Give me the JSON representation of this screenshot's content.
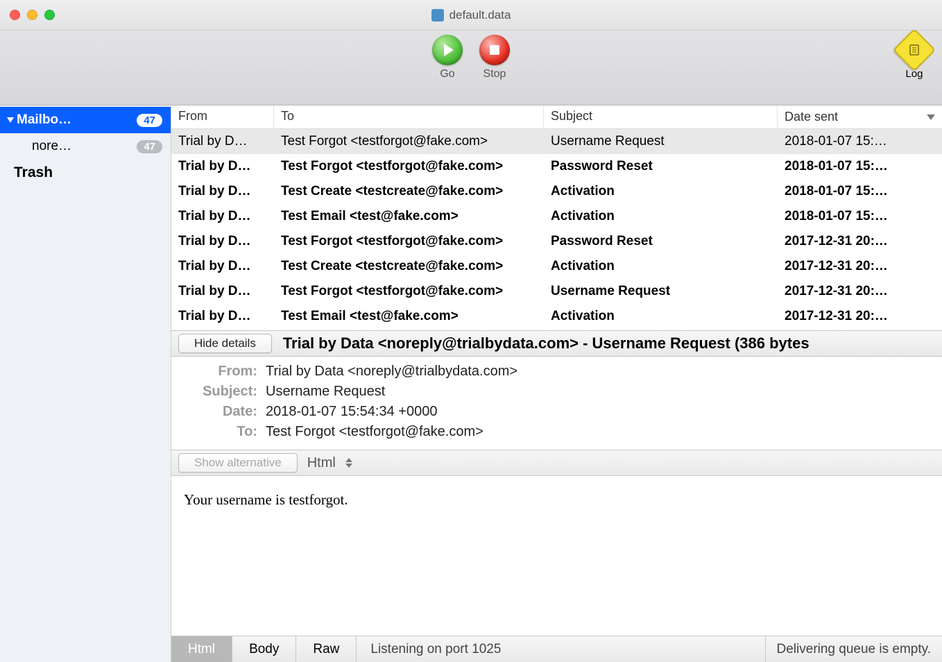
{
  "window": {
    "title": "default.data"
  },
  "toolbar": {
    "go": "Go",
    "stop": "Stop",
    "log": "Log"
  },
  "sidebar": {
    "mailboxes_label": "Mailbo…",
    "mailboxes_count": "47",
    "nore_label": "nore…",
    "nore_count": "47",
    "trash_label": "Trash"
  },
  "columns": {
    "from": "From",
    "to": "To",
    "subject": "Subject",
    "date": "Date sent"
  },
  "messages": [
    {
      "from": "Trial by D…",
      "to": "Test Forgot <testforgot@fake.com>",
      "subject": "Username Request",
      "date": "2018-01-07 15:…",
      "selected": true
    },
    {
      "from": "Trial by D…",
      "to": "Test Forgot <testforgot@fake.com>",
      "subject": "Password Reset",
      "date": "2018-01-07 15:…"
    },
    {
      "from": "Trial by D…",
      "to": "Test Create <testcreate@fake.com>",
      "subject": "Activation",
      "date": "2018-01-07 15:…"
    },
    {
      "from": "Trial by D…",
      "to": "Test Email <test@fake.com>",
      "subject": "Activation",
      "date": "2018-01-07 15:…"
    },
    {
      "from": "Trial by D…",
      "to": "Test Forgot <testforgot@fake.com>",
      "subject": "Password Reset",
      "date": "2017-12-31 20:…"
    },
    {
      "from": "Trial by D…",
      "to": "Test Create <testcreate@fake.com>",
      "subject": "Activation",
      "date": "2017-12-31 20:…"
    },
    {
      "from": "Trial by D…",
      "to": "Test Forgot <testforgot@fake.com>",
      "subject": "Username Request",
      "date": "2017-12-31 20:…"
    },
    {
      "from": "Trial by D…",
      "to": "Test Email <test@fake.com>",
      "subject": "Activation",
      "date": "2017-12-31 20:…"
    }
  ],
  "detailbar": {
    "hide_btn": "Hide details",
    "summary": "Trial by Data <noreply@trialbydata.com> - Username Request (386 bytes"
  },
  "headers": {
    "from_k": "From:",
    "from_v": "Trial by Data <noreply@trialbydata.com>",
    "subj_k": "Subject:",
    "subj_v": "Username Request",
    "date_k": "Date:",
    "date_v": "2018-01-07 15:54:34 +0000",
    "to_k": "To:",
    "to_v": "Test Forgot <testforgot@fake.com>"
  },
  "altbar": {
    "show_alt": "Show alternative",
    "mode": "Html"
  },
  "body": "Your username is testforgot.",
  "bottom": {
    "tab_html": "Html",
    "tab_body": "Body",
    "tab_raw": "Raw",
    "listening": "Listening on port 1025",
    "queue": "Delivering queue is empty."
  }
}
